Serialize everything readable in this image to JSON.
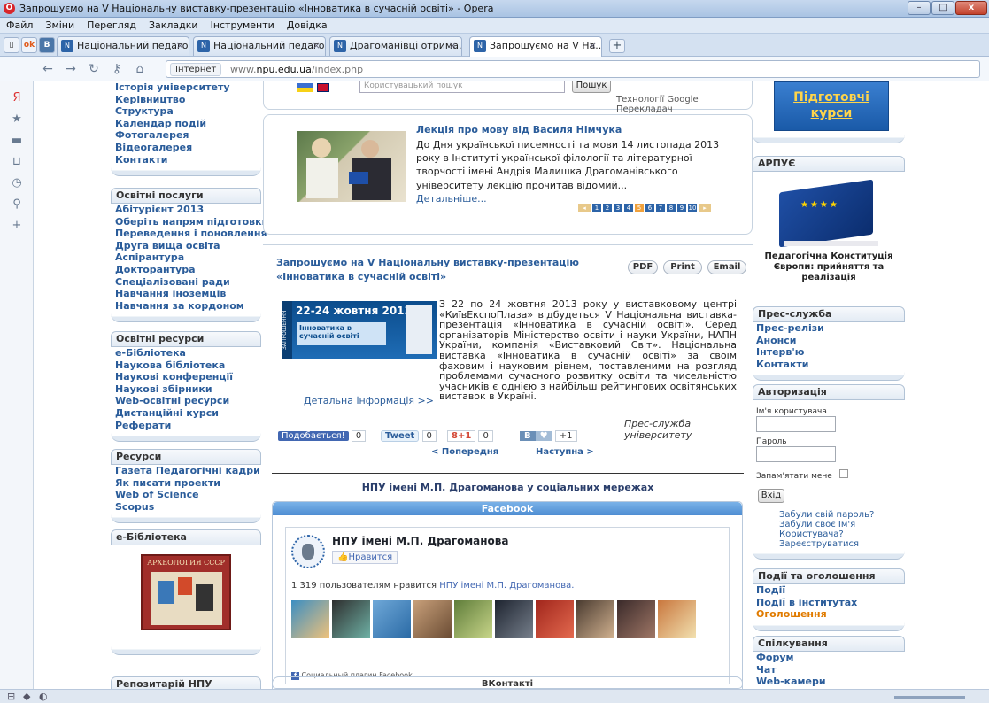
{
  "window": {
    "title": "Запрошуємо на V Національну виставку-презентацію «Інноватика в сучасній освіті» - Opera",
    "controls": {
      "min": "–",
      "max": "□",
      "close": "x"
    }
  },
  "menu": [
    "Файл",
    "Зміни",
    "Перегляд",
    "Закладки",
    "Інструменти",
    "Довідка"
  ],
  "tabs": [
    {
      "label": "Національний педаго...",
      "active": false
    },
    {
      "label": "Національний педаго...",
      "active": false
    },
    {
      "label": "Драгоманівці отрима...",
      "active": false
    },
    {
      "label": "Запрошуємо на V На...",
      "active": true
    }
  ],
  "tab_close": "×",
  "tab_add": "+",
  "mini_tabs": [
    "ok",
    "B"
  ],
  "address": {
    "security": "Інтернет",
    "url_prefix": "www.",
    "url_domain": "npu.edu.ua",
    "url_path": "/index.php"
  },
  "left": {
    "about_links": [
      "Історія університету",
      "Керівництво",
      "Структура",
      "Календар подій",
      "Фотогалерея",
      "Відеогалерея",
      "Контакти"
    ],
    "services": {
      "title": "Освітні послуги",
      "links": [
        "Абітурієнт 2013",
        "Оберіть напрям підготовки",
        "Переведення і поновлення",
        "Друга вища освіта",
        "Аспірантура",
        "Докторантура",
        "Спеціалізовані ради",
        "Навчання іноземців",
        "Навчання за кордоном"
      ]
    },
    "resources": {
      "title": "Освітні ресурси",
      "links": [
        "e-Бібліотека",
        "Наукова бібліотека",
        "Наукові конференції",
        "Наукові збірники",
        "Web-освітні ресурси",
        "Дистанційні курси",
        "Реферати"
      ]
    },
    "res2": {
      "title": "Ресурси",
      "links": [
        "Газета Педагогічні кадри",
        "Як писати проекти",
        "Web of Science",
        "Scopus"
      ]
    },
    "elib": {
      "title": "e-Бібліотека",
      "book_title": "АРХЕОЛОГИЯ СССР"
    },
    "repo": {
      "title": "Репозитарій НПУ"
    }
  },
  "top": {
    "search_placeholder": "Користувацький пошук",
    "search_button": "Пошук",
    "translate": "Технології Google Перекладач"
  },
  "lecture": {
    "title": "Лекція про мову від Василя Німчука",
    "body": "До Дня української писемності та мови 14 листопада 2013 року в Інституті української філології та літературної творчості імені Андрія Малишка Драгоманівського університету лекцію прочитав відомий...",
    "more": "Детальніше...",
    "pages": [
      "1",
      "2",
      "3",
      "4",
      "5",
      "6",
      "7",
      "8",
      "9",
      "10"
    ],
    "current_page": "5"
  },
  "article": {
    "title": "Запрошуємо на V Національну виставку-презентацію «Інноватика в сучасній освіті»",
    "buttons": {
      "pdf": "PDF",
      "print": "Print",
      "email": "Email"
    },
    "banner_dates": "22-24 жовтня 2013",
    "banner_title": "Інноватика в сучасній освіті",
    "banner_side": "ЗАПРОШЕННЯ",
    "text": "З 22 по 24 жовтня 2013 року у виставковому центрі «КиївЕкспоПлаза» відбудеться V Національна виставка-презентація «Інноватика в сучасній освіті». Серед організаторів Міністерство освіти і науки України, НАПН України, компанія «Виставковий Світ». Національна виставка «Інноватика в сучасній освіті» за своїм фаховим і науковим рівнем, поставленими на розгляд проблемами сучасного розвитку освіти та чисельністю учасників є однією з найбільш рейтингових освітянських виставок в Україні.",
    "details": "Детальна інформація >>",
    "signature": "Прес-служба університету",
    "social": {
      "fb": "Подобається!",
      "fb_count": "0",
      "tweet": "Tweet",
      "tw_count": "0",
      "gp": "8+1",
      "gp_count": "0",
      "b": "B",
      "b_count": "+1"
    },
    "prev": "< Попередня",
    "next": "Наступна >"
  },
  "social_section": {
    "heading": "НПУ імені М.П. Драгоманова у соціальних мережах",
    "facebook_title": "Facebook",
    "page_name": "НПУ імені М.П. Драгоманова",
    "like_button": "Нравится",
    "likes_text": "1 319 пользователям нравится",
    "likes_link": "НПУ імені М.П. Драгоманова.",
    "plugin": "Социальный плагин Facebook",
    "vk_title": "ВКонтакті"
  },
  "right": {
    "courses": "Підготовчі курси",
    "arpue": {
      "title": "АРПУЄ",
      "caption": "Педагогічна Конституція Європи: прийняття та реалізація"
    },
    "press": {
      "title": "Прес-служба",
      "links": [
        "Прес-релізи",
        "Анонси",
        "Інтерв'ю",
        "Контакти"
      ]
    },
    "auth": {
      "title": "Авторизація",
      "username": "Ім'я користувача",
      "password": "Пароль",
      "remember": "Запам'ятати мене",
      "login": "Вхід",
      "links": [
        "Забули свій пароль?",
        "Забули своє Ім'я Користувача?",
        "Зареєструватися"
      ]
    },
    "events": {
      "title": "Події та оголошення",
      "links": [
        "Події",
        "Події в інститутах",
        "Оголошення"
      ]
    },
    "chat": {
      "title": "Спілкування",
      "links": [
        "Форум",
        "Чат",
        "Web-камери"
      ]
    }
  },
  "colors": {
    "link": "#2a5c9a",
    "announce": "#e07b00",
    "pager_current": "#f0a13c"
  }
}
